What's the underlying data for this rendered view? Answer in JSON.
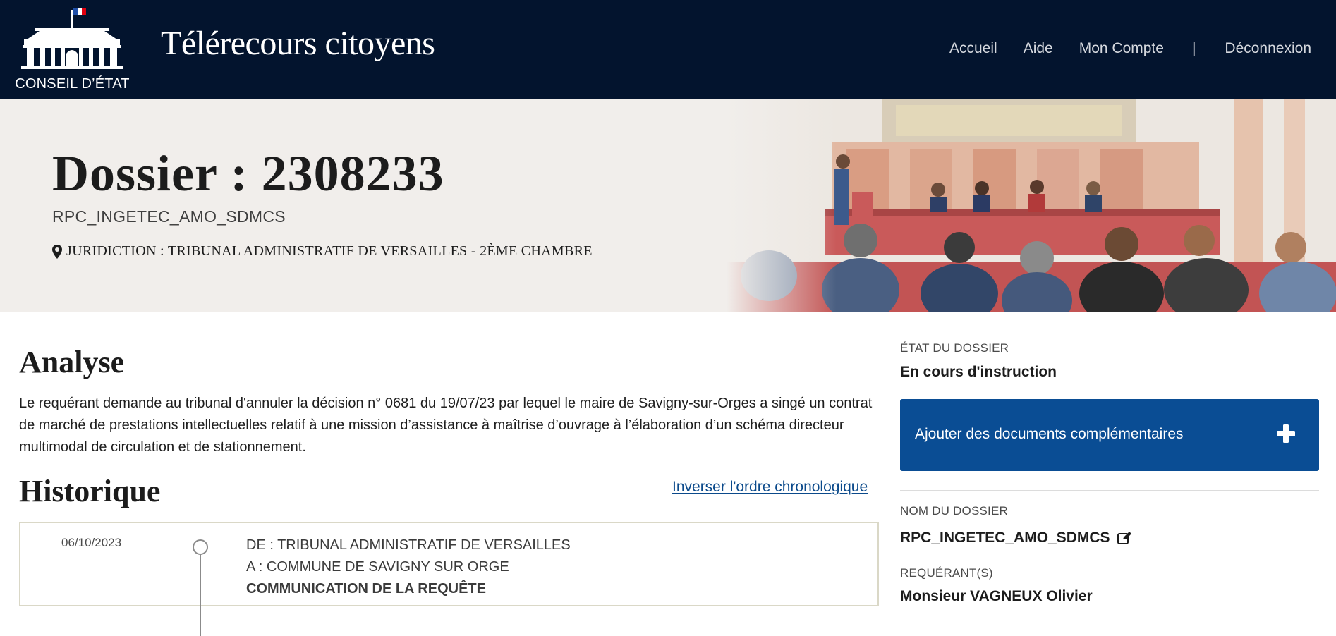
{
  "header": {
    "logo_text": "CONSEIL D’ÉTAT",
    "app_title": "Télérecours citoyens",
    "nav": {
      "home": "Accueil",
      "help": "Aide",
      "account": "Mon Compte",
      "separator": "|",
      "logout": "Déconnexion"
    }
  },
  "hero": {
    "title": "Dossier : 2308233",
    "subtitle": "RPC_INGETEC_AMO_SDMCS",
    "juridiction": "JURIDICTION : TRIBUNAL ADMINISTRATIF DE VERSAILLES - 2ÈME CHAMBRE"
  },
  "analyse": {
    "title": "Analyse",
    "text": "Le requérant demande au tribunal d'annuler la décision n° 0681 du 19/07/23 par lequel le maire de Savigny-sur-Orges a singé un contrat de marché de prestations intellectuelles relatif à une mission d’assistance à maîtrise d’ouvrage à l’élaboration d’un schéma directeur multimodal de circulation et de stationnement."
  },
  "historique": {
    "title": "Historique",
    "invert_link": "Inverser l'ordre chronologique",
    "entries": [
      {
        "date": "06/10/2023",
        "from": "DE : TRIBUNAL ADMINISTRATIF DE VERSAILLES",
        "to": "A : COMMUNE DE SAVIGNY SUR ORGE",
        "event": "COMMUNICATION DE LA REQUÊTE"
      }
    ]
  },
  "sidebar": {
    "etat_label": "ÉTAT DU DOSSIER",
    "etat_value": "En cours d'instruction",
    "add_docs_button": "Ajouter des documents complémentaires",
    "nom_label": "NOM DU DOSSIER",
    "nom_value": "RPC_INGETEC_AMO_SDMCS",
    "requerant_label": "REQUÉRANT(S)",
    "requerant_value": "Monsieur VAGNEUX Olivier"
  },
  "colors": {
    "navbar_bg": "#03142e",
    "hero_bg": "#f1eeeb",
    "button_blue": "#0a4d94",
    "link_blue": "#0b4a8b"
  },
  "icons": [
    "conseil-etat-logo",
    "map-marker-icon",
    "plus-icon",
    "edit-icon"
  ]
}
